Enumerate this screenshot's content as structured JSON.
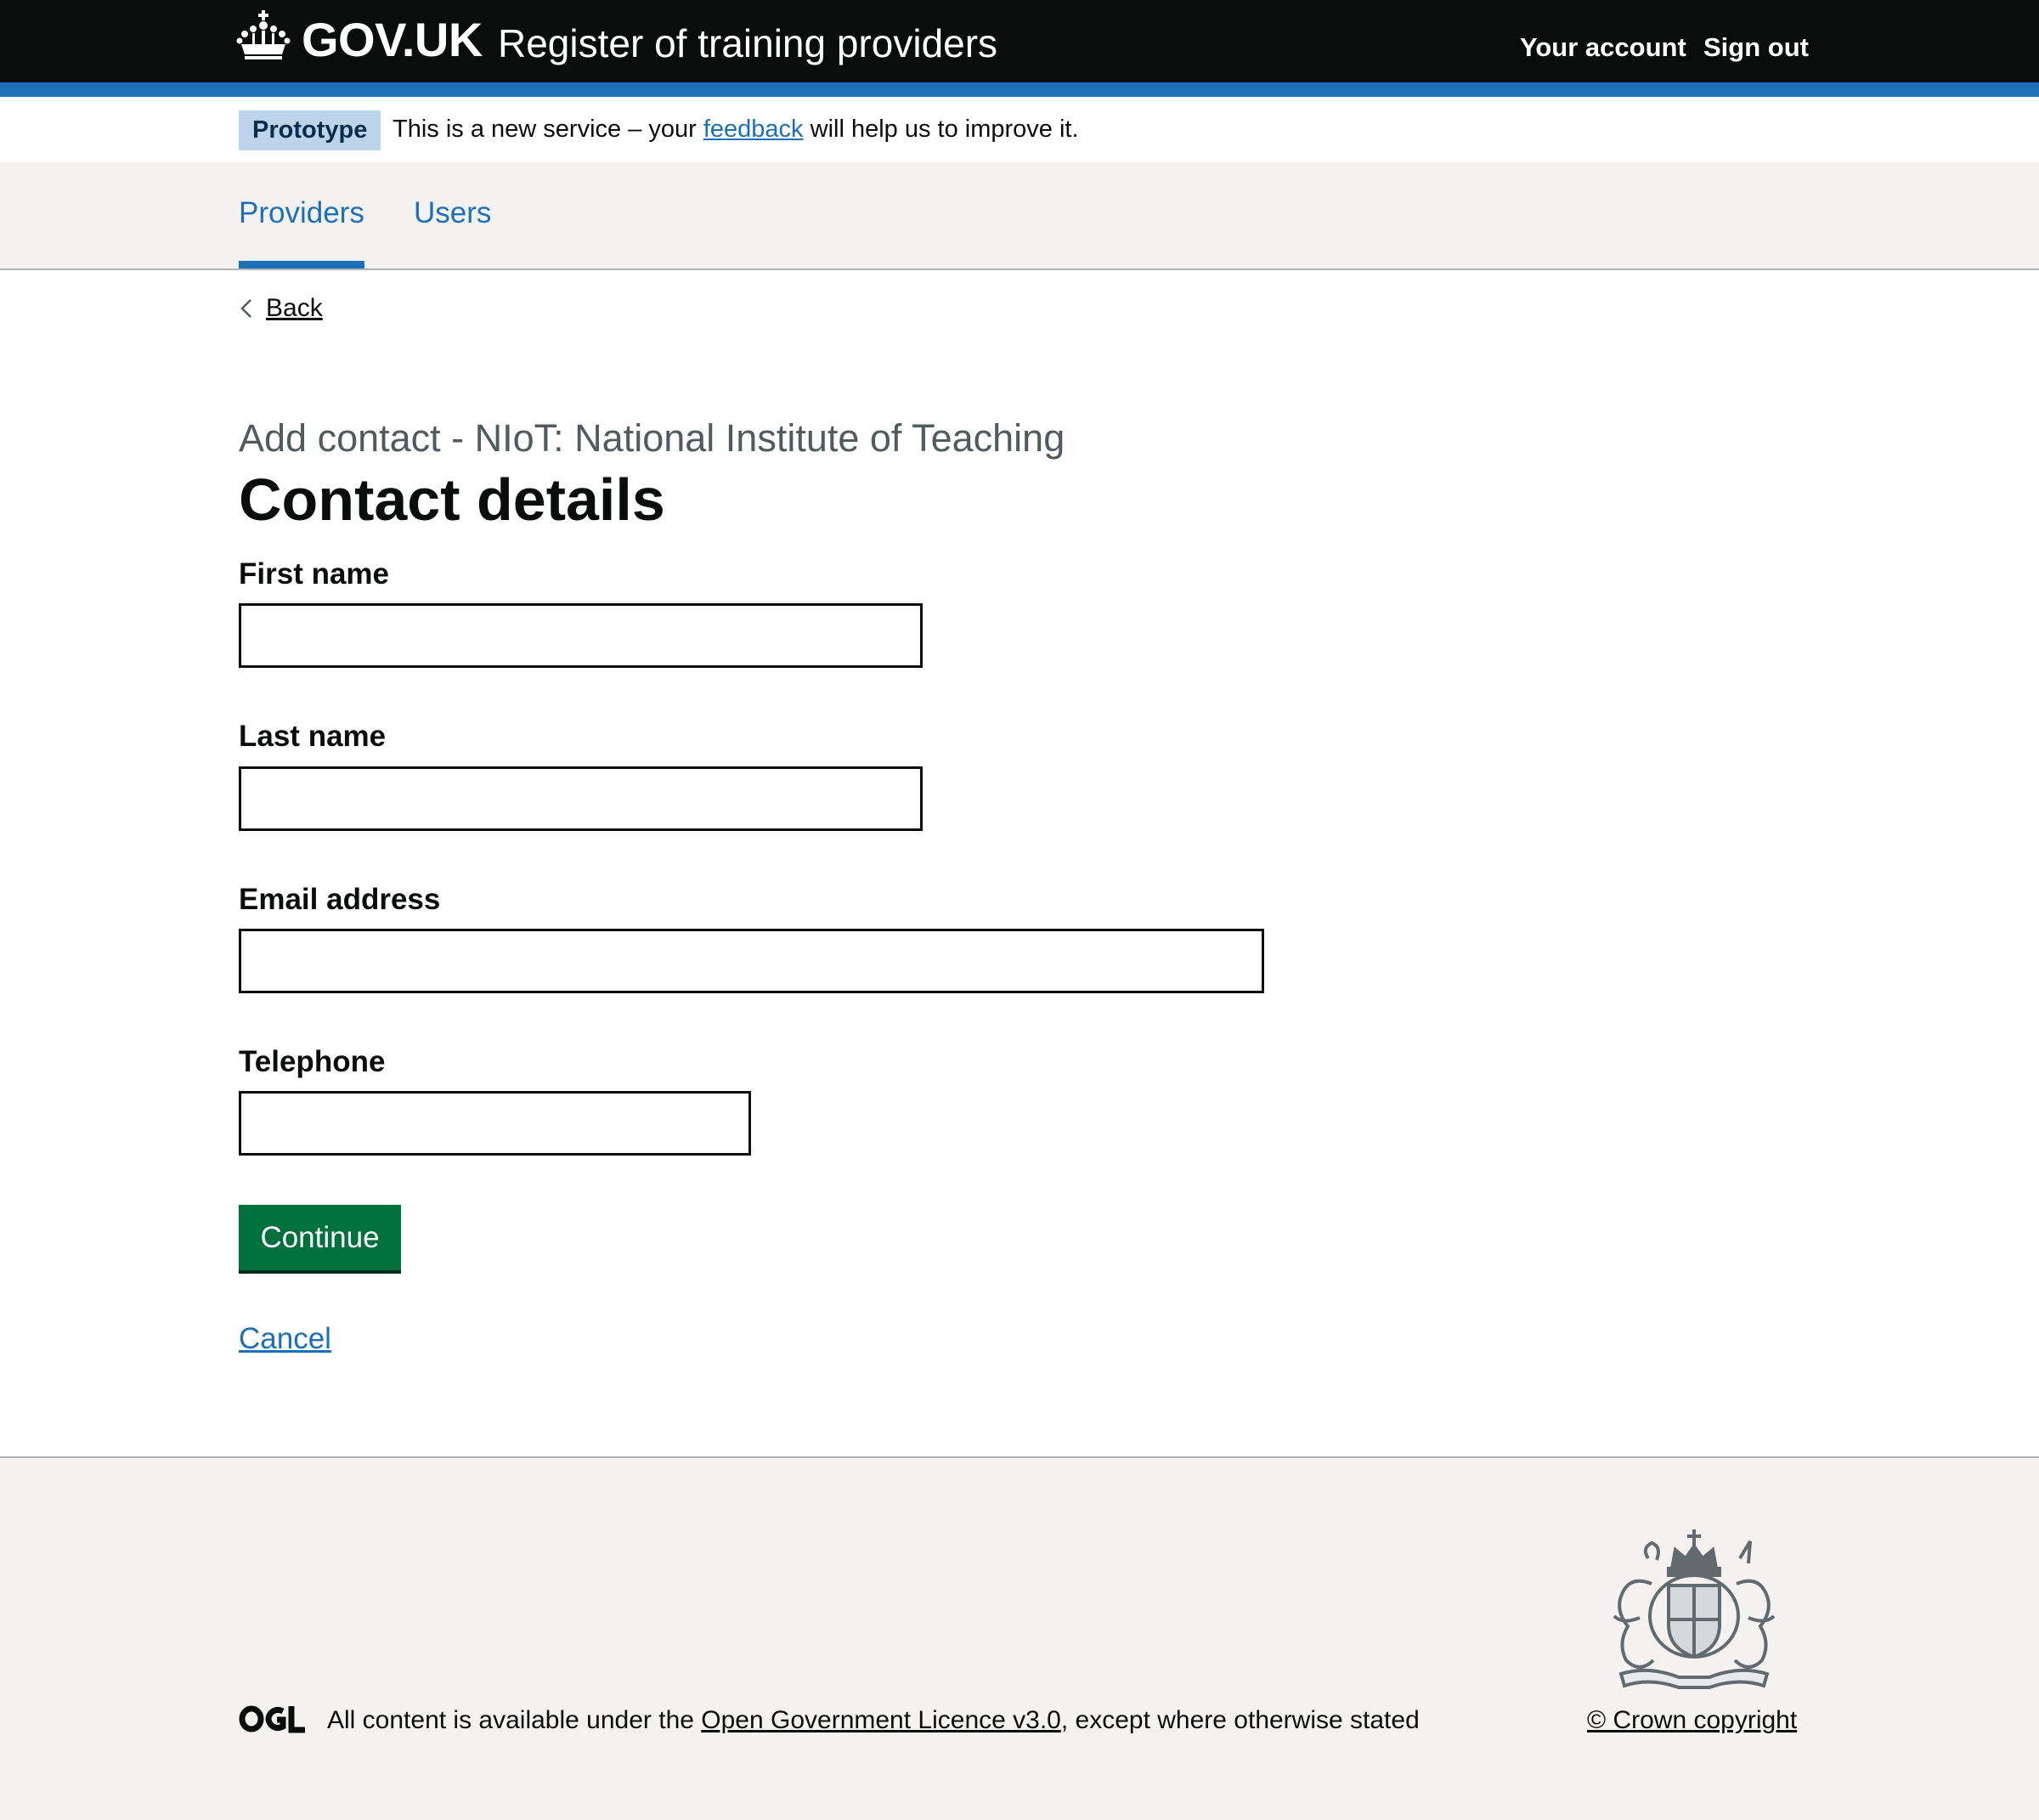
{
  "header": {
    "wordmark": "GOV.UK",
    "service_name": "Register of training providers",
    "links": {
      "your_account": "Your account",
      "sign_out": "Sign out"
    }
  },
  "phase_banner": {
    "tag": "Prototype",
    "text_before": "This is a new service – your ",
    "link": "feedback",
    "text_after": " will help us to improve it."
  },
  "nav": {
    "items": [
      {
        "label": "Providers",
        "active": true
      },
      {
        "label": "Users",
        "active": false
      }
    ]
  },
  "main": {
    "back_label": "Back",
    "caption": "Add contact - NIoT: National Institute of Teaching",
    "title": "Contact details",
    "fields": {
      "first_name": {
        "label": "First name",
        "value": ""
      },
      "last_name": {
        "label": "Last name",
        "value": ""
      },
      "email": {
        "label": "Email address",
        "value": ""
      },
      "telephone": {
        "label": "Telephone",
        "value": ""
      }
    },
    "continue_label": "Continue",
    "cancel_label": "Cancel"
  },
  "footer": {
    "ogl_logo": "OGL",
    "licence_before": "All content is available under the ",
    "licence_link": "Open Government Licence v3.0",
    "licence_after": ", except where otherwise stated",
    "crown_copyright": "© Crown copyright"
  },
  "colors": {
    "header_bg": "#0b0c0c",
    "brand_blue": "#1d70b8",
    "button_green": "#00703c",
    "tag_bg": "#bbd4ea",
    "footer_bg": "#f3f2f1"
  },
  "icons": {
    "crown": "crown-icon",
    "back": "chevron-left-icon",
    "crest": "royal-coat-of-arms-icon"
  }
}
